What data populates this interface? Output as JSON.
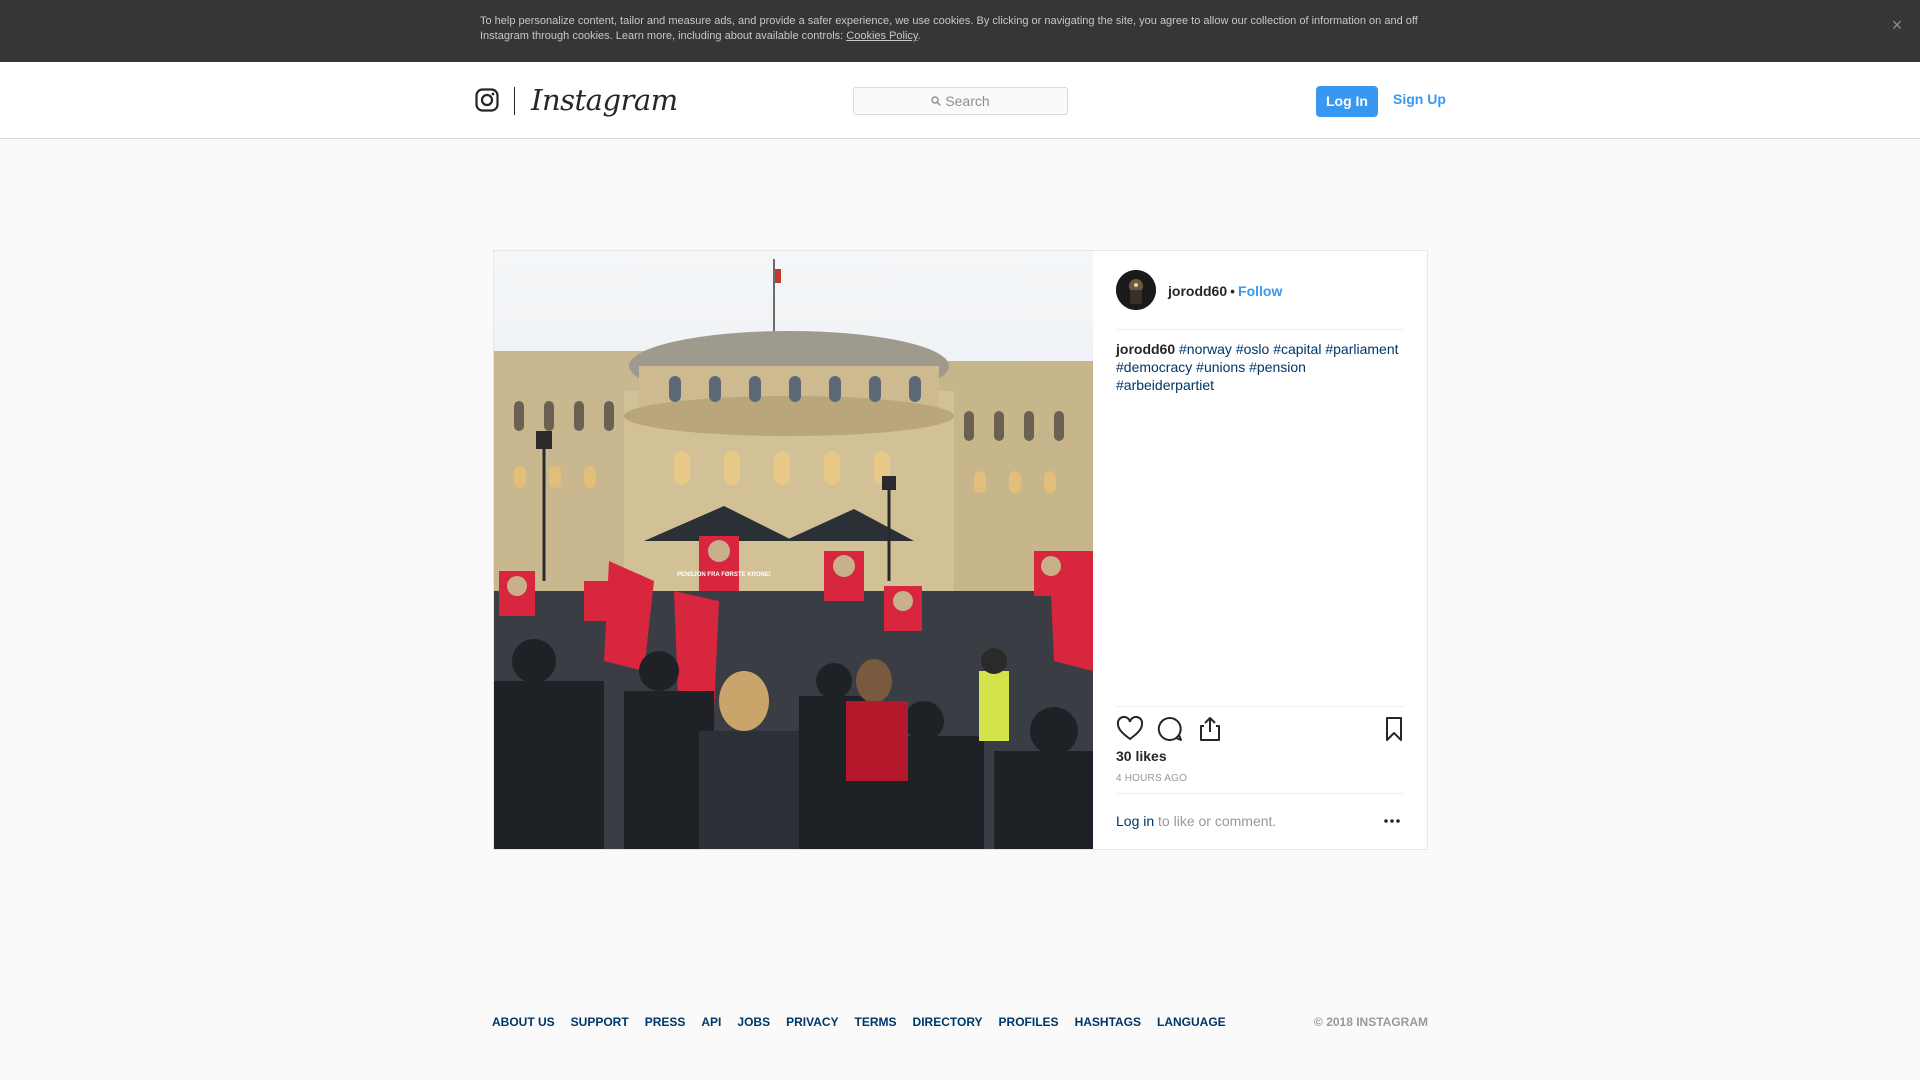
{
  "cookie_banner": {
    "text": "To help personalize content, tailor and measure ads, and provide a safer experience, we use cookies. By clicking or navigating the site, you agree to allow our collection of information on and off Instagram through cookies. Learn more, including about available controls: ",
    "link_label": "Cookies Policy",
    "close_glyph": "×"
  },
  "header": {
    "wordmark": "Instagram",
    "search_placeholder": "Search",
    "login_label": "Log In",
    "signup_label": "Sign Up"
  },
  "post": {
    "owner": "jorodd60",
    "separator": "•",
    "follow_label": "Follow",
    "caption_user": "jorodd60",
    "hashtags": [
      "#norway",
      "#oslo",
      "#capital",
      "#parliament",
      "#democracy",
      "#unions",
      "#pension",
      "#arbeiderpartiet"
    ],
    "likes": "30 likes",
    "time_ago": "4 HOURS AGO",
    "login_prompt_link": "Log in",
    "login_prompt_rest": " to like or comment.",
    "photo_banner_text": "PENSJON FRA FØRSTE KRONE!"
  },
  "footer": {
    "links": [
      "About us",
      "Support",
      "Press",
      "API",
      "Jobs",
      "Privacy",
      "Terms",
      "Directory",
      "Profiles",
      "Hashtags",
      "Language"
    ],
    "copyright": "© 2018 Instagram"
  },
  "colors": {
    "accent": "#3897f0",
    "link_dark": "#003569",
    "banner_bg": "#363636",
    "flag_red": "#d7263d"
  },
  "icons": [
    "close-icon",
    "instagram-glyph-icon",
    "search-icon",
    "heart-icon",
    "comment-icon",
    "share-icon",
    "bookmark-icon",
    "more-options-icon"
  ]
}
